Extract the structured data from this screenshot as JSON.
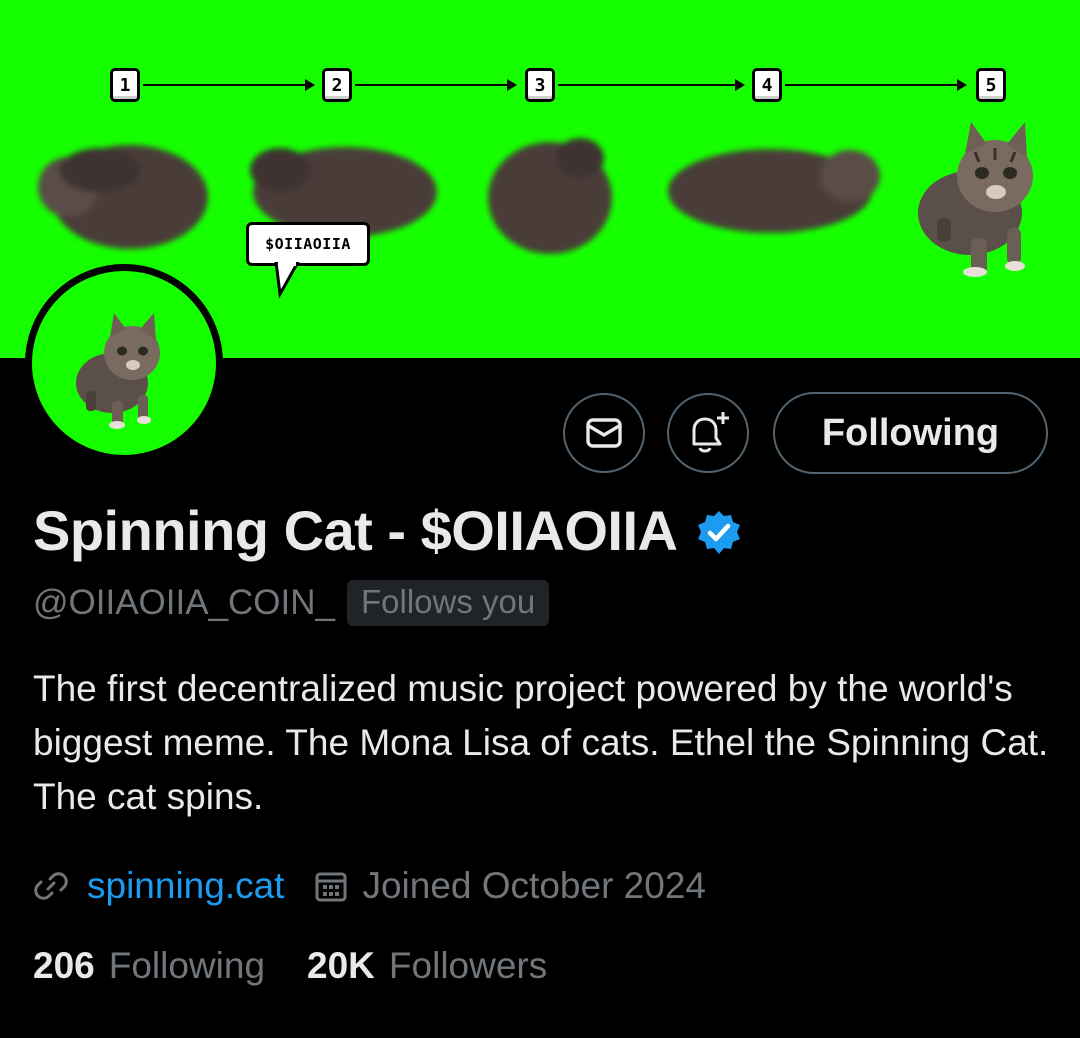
{
  "banner": {
    "background": "#16ff00",
    "steps": [
      "1",
      "2",
      "3",
      "4",
      "5"
    ],
    "speech_bubble": "$OIIAOIIA"
  },
  "profile": {
    "display_name": "Spinning Cat - $OIIAOIIA",
    "verified_icon": "verified-badge-icon",
    "handle": "@OIIAOIIA_COIN_",
    "follows_you": "Follows you",
    "bio": "The first decentralized music project powered by the world's biggest meme. The Mona Lisa of cats. Ethel the Spinning Cat. The cat spins.",
    "website": "spinning.cat",
    "joined": "Joined October 2024"
  },
  "actions": {
    "message_icon": "envelope-icon",
    "notify_icon": "bell-plus-icon",
    "follow_label": "Following"
  },
  "stats": {
    "following_count": "206",
    "following_label": "Following",
    "followers_count": "20K",
    "followers_label": "Followers"
  },
  "colors": {
    "accent": "#1d9bf0",
    "muted_text": "#71767b",
    "text": "#e7e9ea",
    "border": "#536471",
    "badge_bg": "#202327"
  }
}
